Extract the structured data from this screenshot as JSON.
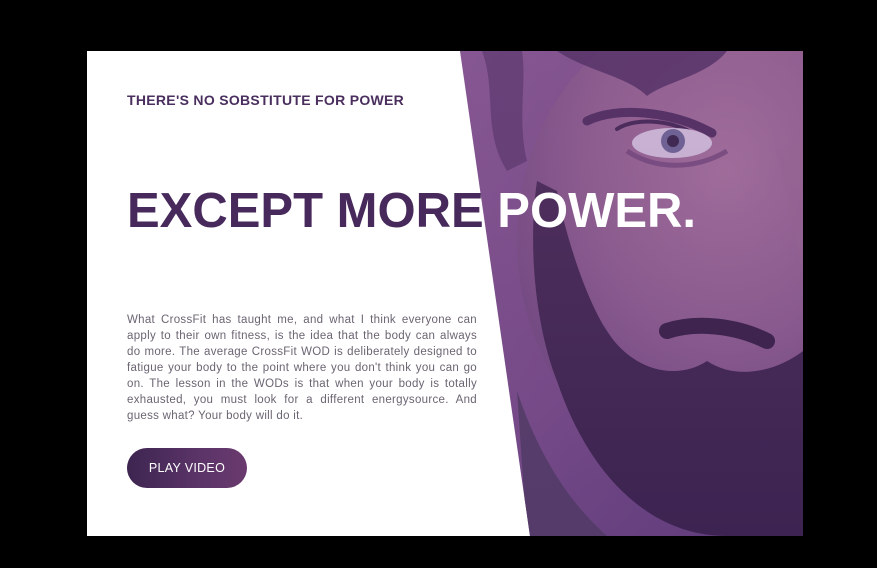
{
  "hero": {
    "eyebrow": "THERE'S NO SOBSTITUTE FOR POWER",
    "headline_dark": "EXCEPT MORE",
    "headline_light": "POWER.",
    "body": "What CrossFit has taught me, and what I think everyone can apply to their own fitness, is the idea that the body can always do more. The average CrossFit WOD is deliberately designed to fatigue your body to the point where you don't think you can go on. The lesson in the WODs is that when your body is totally exhausted, you must look for a different energysource. And guess what? Your body will do it.",
    "button_label": "PLAY VIDEO"
  },
  "colors": {
    "page_background": "#000000",
    "card_background": "#ffffff",
    "headline_dark": "#47295c",
    "headline_light": "#ffffff",
    "eyebrow": "#4a2f5e",
    "body_text": "#6c6472",
    "button_start": "#3d2550",
    "button_end": "#6a3a6e",
    "photo_tint": "#6b3f86"
  }
}
